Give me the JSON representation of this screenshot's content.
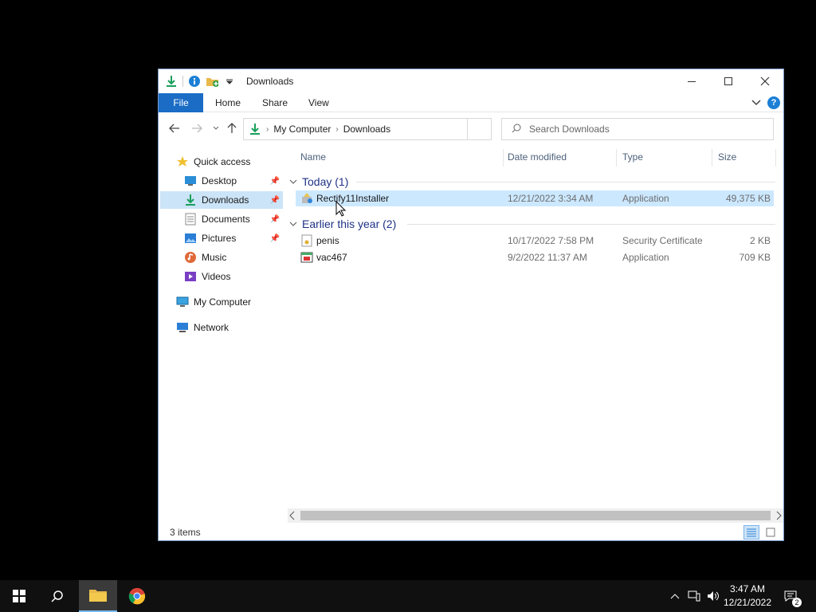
{
  "window": {
    "title": "Downloads",
    "ribbon": {
      "file": "File",
      "home": "Home",
      "share": "Share",
      "view": "View",
      "help": "?"
    },
    "address": {
      "crumbs": [
        "My Computer",
        "Downloads"
      ]
    },
    "search": {
      "placeholder": "Search Downloads"
    }
  },
  "nav": {
    "quick_access": "Quick access",
    "items": [
      {
        "label": "Desktop",
        "pinned": true
      },
      {
        "label": "Downloads",
        "pinned": true,
        "selected": true
      },
      {
        "label": "Documents",
        "pinned": true
      },
      {
        "label": "Pictures",
        "pinned": true
      },
      {
        "label": "Music",
        "pinned": false
      },
      {
        "label": "Videos",
        "pinned": false
      }
    ],
    "my_computer": "My Computer",
    "network": "Network"
  },
  "columns": {
    "name": "Name",
    "date": "Date modified",
    "type": "Type",
    "size": "Size"
  },
  "groups": [
    {
      "label": "Today (1)",
      "files": [
        {
          "name": "Rectify11Installer",
          "date": "12/21/2022 3:34 AM",
          "type": "Application",
          "size": "49,375 KB",
          "icon": "installer-icon"
        }
      ]
    },
    {
      "label": "Earlier this year (2)",
      "files": [
        {
          "name": "penis",
          "date": "10/17/2022 7:58 PM",
          "type": "Security Certificate",
          "size": "2 KB",
          "icon": "certificate-icon"
        },
        {
          "name": "vac467",
          "date": "9/2/2022 11:37 AM",
          "type": "Application",
          "size": "709 KB",
          "icon": "application-icon"
        }
      ]
    }
  ],
  "status": {
    "items": "3 items"
  },
  "taskbar": {
    "time": "3:47 AM",
    "date": "12/21/2022",
    "notifications": "2"
  },
  "colors": {
    "accent": "#1b6cc5",
    "selection": "#cce8ff",
    "taskbar": "#101010"
  }
}
